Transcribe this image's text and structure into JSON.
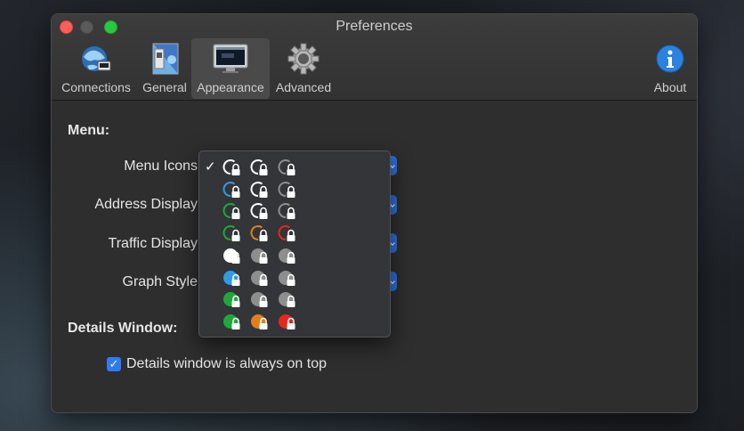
{
  "window": {
    "title": "Preferences"
  },
  "toolbar": {
    "tabs": [
      {
        "label": "Connections",
        "icon": "globe-connections-icon"
      },
      {
        "label": "General",
        "icon": "general-switch-icon"
      },
      {
        "label": "Appearance",
        "icon": "monitor-icon",
        "selected": true
      },
      {
        "label": "Advanced",
        "icon": "gear-icon"
      }
    ],
    "about": {
      "label": "About",
      "icon": "info-icon"
    }
  },
  "menu_section": {
    "title": "Menu:",
    "rows": [
      {
        "label": "Menu Icons"
      },
      {
        "label": "Address Display"
      },
      {
        "label": "Traffic Display"
      },
      {
        "label": "Graph Style"
      }
    ]
  },
  "details_section": {
    "title": "Details Window:",
    "always_on_top": {
      "label": "Details window is always on top",
      "checked": true
    }
  },
  "icon_menu": {
    "selected_index": 0,
    "check_glyph": "✓",
    "options": [
      [
        "ring-white",
        "ring-white",
        "ring-gray"
      ],
      [
        "ring-blue",
        "ring-white",
        "ring-gray"
      ],
      [
        "ring-green",
        "ring-white",
        "ring-gray"
      ],
      [
        "ring-green",
        "ring-orange",
        "ring-red"
      ],
      [
        "solid-white",
        "solid-gray",
        "solid-gray"
      ],
      [
        "solid-blue",
        "solid-gray",
        "solid-gray"
      ],
      [
        "solid-green",
        "solid-gray",
        "solid-gray"
      ],
      [
        "solid-green",
        "solid-orange",
        "solid-red"
      ]
    ]
  },
  "colors": {
    "white": "#ffffff",
    "gray": "#8e8e8e",
    "blue": "#2f9be8",
    "green": "#1fa83a",
    "orange": "#e0801c",
    "red": "#e8261e",
    "accent": "#2f7bf6"
  }
}
